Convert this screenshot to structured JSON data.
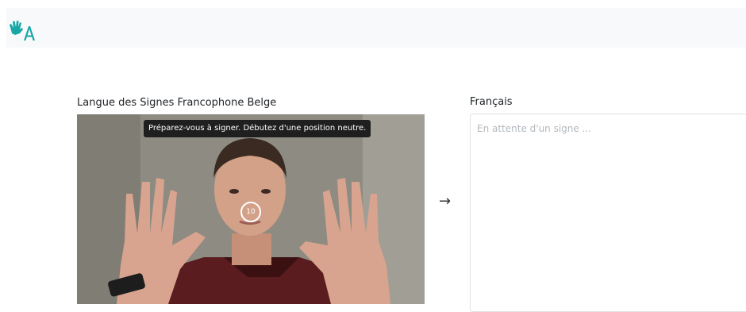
{
  "navbar": {
    "logo_icon": "sign-hand-a-icon",
    "brand_color": "#18a6a6"
  },
  "source": {
    "label": "Langue des Signes Francophone Belge"
  },
  "camera": {
    "tooltip": "Préparez-vous à signer. Débutez d'une position neutre.",
    "countdown": "10"
  },
  "arrow_icon": "arrow-right-icon",
  "target": {
    "label": "Français",
    "placeholder": "En attente d'un signe ..."
  }
}
